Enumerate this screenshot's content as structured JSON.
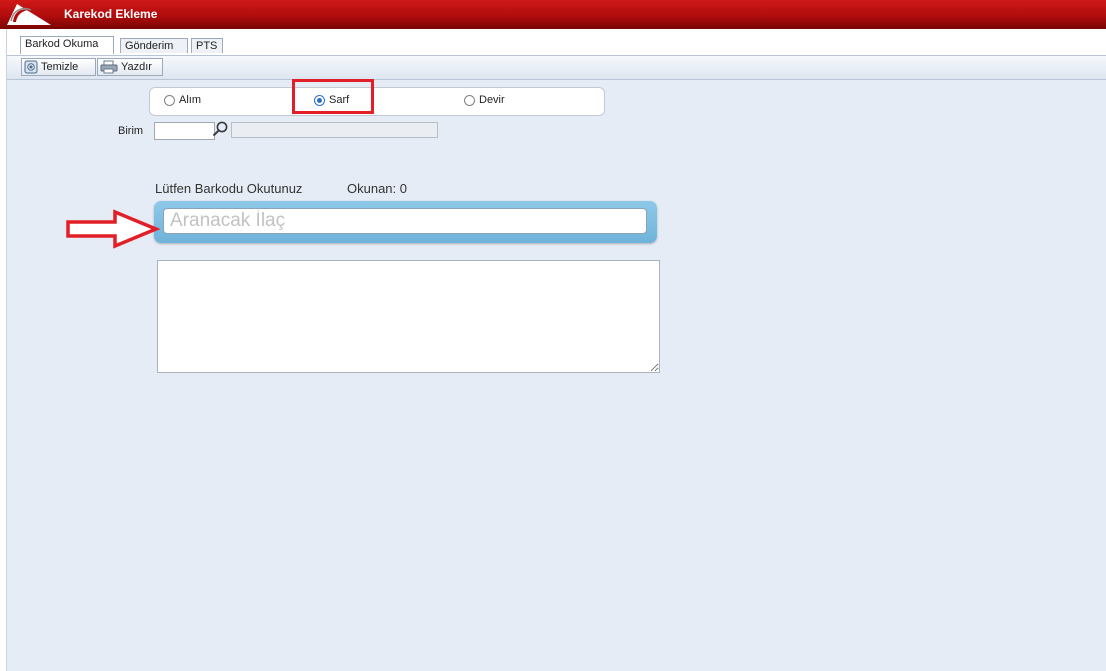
{
  "window": {
    "title": "Karekod Ekleme"
  },
  "tabs": [
    {
      "label": "Barkod Okuma",
      "active": true
    },
    {
      "label": "Gönderim",
      "active": false
    },
    {
      "label": "PTS",
      "active": false
    }
  ],
  "toolbar": {
    "clear_label": "Temizle",
    "print_label": "Yazdır"
  },
  "transaction_type": {
    "options": [
      {
        "label": "Alım",
        "checked": false
      },
      {
        "label": "Sarf",
        "checked": true
      },
      {
        "label": "Devir",
        "checked": false
      }
    ]
  },
  "birim": {
    "label": "Birim",
    "code_value": "",
    "name_value": ""
  },
  "barcode": {
    "prompt": "Lütfen Barkodu Okutunuz",
    "count_text": "Okunan: 0",
    "search_placeholder": "Aranacak İlaç",
    "search_value": ""
  },
  "results": {
    "value": ""
  },
  "colors": {
    "titlebar": "#c00f0f",
    "window_bg": "#e6ecf5",
    "search_frame": "#7fbde0",
    "annotation": "#e21e26",
    "radio_checked": "#2a6fd0"
  },
  "icons": {
    "clear_button_icon": "eraser-icon",
    "print_button_icon": "printer-icon",
    "birim_lookup_icon": "search-icon"
  }
}
